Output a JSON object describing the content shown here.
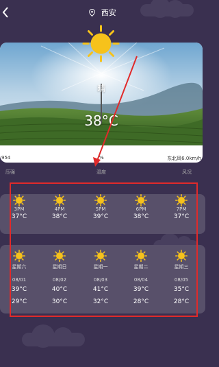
{
  "header": {
    "location": "西安"
  },
  "current": {
    "condition": "晴",
    "temperature": "38°C",
    "pressure_value": "954",
    "humidity_value": "%",
    "wind_value": "东北风6.0km/h",
    "pressure_label": "压强",
    "humidity_label": "湿度",
    "wind_label": "风况"
  },
  "hourly": [
    {
      "time": "3PM",
      "temp": "37°C",
      "icon": "sun-icon"
    },
    {
      "time": "4PM",
      "temp": "38°C",
      "icon": "sun-icon"
    },
    {
      "time": "5PM",
      "temp": "39°C",
      "icon": "sun-icon"
    },
    {
      "time": "6PM",
      "temp": "38°C",
      "icon": "sun-icon"
    },
    {
      "time": "7PM",
      "temp": "37°C",
      "icon": "sun-icon"
    }
  ],
  "daily": [
    {
      "weekday": "星期六",
      "date": "08/01",
      "high": "39°C",
      "low": "29°C",
      "icon": "sun-icon"
    },
    {
      "weekday": "星期日",
      "date": "08/02",
      "high": "40°C",
      "low": "30°C",
      "icon": "sun-icon"
    },
    {
      "weekday": "星期一",
      "date": "08/03",
      "high": "41°C",
      "low": "32°C",
      "icon": "sun-icon"
    },
    {
      "weekday": "星期二",
      "date": "08/04",
      "high": "39°C",
      "low": "28°C",
      "icon": "sun-icon"
    },
    {
      "weekday": "星期三",
      "date": "08/05",
      "high": "35°C",
      "low": "28°C",
      "icon": "sun-icon"
    }
  ],
  "colors": {
    "background": "#3a3050",
    "panel": "#58506a",
    "highlight": "#e12a2a",
    "sun": "#f6c21b"
  }
}
